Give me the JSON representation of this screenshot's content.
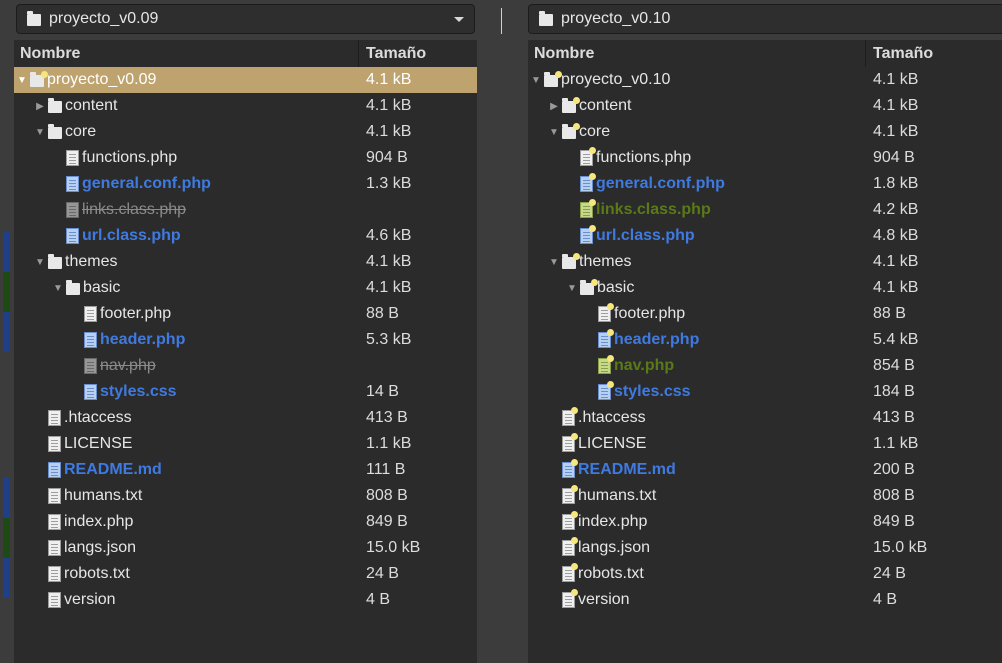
{
  "left": {
    "path": "proyecto_v0.09",
    "columns": {
      "name": "Nombre",
      "size": "Tamaño"
    },
    "rows": [
      {
        "name": "proyecto_v0.09",
        "size": "4.1 kB",
        "type": "folder",
        "state": "normal",
        "expander": "open",
        "depth": 0,
        "star": true,
        "selected": true
      },
      {
        "name": "content",
        "size": "4.1 kB",
        "type": "folder",
        "state": "normal",
        "expander": "closed",
        "depth": 1
      },
      {
        "name": "core",
        "size": "4.1 kB",
        "type": "folder",
        "state": "normal",
        "expander": "open",
        "depth": 1
      },
      {
        "name": "functions.php",
        "size": "904 B",
        "type": "file",
        "state": "normal",
        "depth": 2
      },
      {
        "name": "general.conf.php",
        "size": "1.3 kB",
        "type": "file",
        "state": "modified",
        "depth": 2
      },
      {
        "name": "links.class.php",
        "size": "",
        "type": "file",
        "state": "missing",
        "depth": 2
      },
      {
        "name": "url.class.php",
        "size": "4.6 kB",
        "type": "file",
        "state": "modified",
        "depth": 2
      },
      {
        "name": "themes",
        "size": "4.1 kB",
        "type": "folder",
        "state": "normal",
        "expander": "open",
        "depth": 1
      },
      {
        "name": "basic",
        "size": "4.1 kB",
        "type": "folder",
        "state": "normal",
        "expander": "open",
        "depth": 2
      },
      {
        "name": "footer.php",
        "size": "88 B",
        "type": "file",
        "state": "normal",
        "depth": 3
      },
      {
        "name": "header.php",
        "size": "5.3 kB",
        "type": "file",
        "state": "modified",
        "depth": 3
      },
      {
        "name": "nav.php",
        "size": "",
        "type": "file",
        "state": "missing",
        "depth": 3
      },
      {
        "name": "styles.css",
        "size": "14 B",
        "type": "file",
        "state": "modified",
        "depth": 3
      },
      {
        "name": ".htaccess",
        "size": "413 B",
        "type": "file",
        "state": "normal",
        "depth": 1
      },
      {
        "name": "LICENSE",
        "size": "1.1 kB",
        "type": "file",
        "state": "normal",
        "depth": 1
      },
      {
        "name": "README.md",
        "size": "111 B",
        "type": "file",
        "state": "modified",
        "depth": 1
      },
      {
        "name": "humans.txt",
        "size": "808 B",
        "type": "file",
        "state": "normal",
        "depth": 1
      },
      {
        "name": "index.php",
        "size": "849 B",
        "type": "file",
        "state": "normal",
        "depth": 1
      },
      {
        "name": "langs.json",
        "size": "15.0 kB",
        "type": "file",
        "state": "normal",
        "depth": 1
      },
      {
        "name": "robots.txt",
        "size": "24 B",
        "type": "file",
        "state": "normal",
        "depth": 1
      },
      {
        "name": "version",
        "size": "4 B",
        "type": "file",
        "state": "normal",
        "depth": 1
      }
    ]
  },
  "right": {
    "path": "proyecto_v0.10",
    "columns": {
      "name": "Nombre",
      "size": "Tamaño"
    },
    "rows": [
      {
        "name": "proyecto_v0.10",
        "size": "4.1 kB",
        "type": "folder",
        "state": "normal",
        "expander": "open",
        "depth": 0,
        "star": true
      },
      {
        "name": "content",
        "size": "4.1 kB",
        "type": "folder",
        "state": "normal",
        "expander": "closed",
        "depth": 1,
        "star": true
      },
      {
        "name": "core",
        "size": "4.1 kB",
        "type": "folder",
        "state": "normal",
        "expander": "open",
        "depth": 1,
        "star": true
      },
      {
        "name": "functions.php",
        "size": "904 B",
        "type": "file",
        "state": "normal",
        "depth": 2,
        "star": true
      },
      {
        "name": "general.conf.php",
        "size": "1.8 kB",
        "type": "file",
        "state": "modified",
        "depth": 2,
        "star": true
      },
      {
        "name": "links.class.php",
        "size": "4.2 kB",
        "type": "file",
        "state": "added",
        "depth": 2,
        "star": true
      },
      {
        "name": "url.class.php",
        "size": "4.8 kB",
        "type": "file",
        "state": "modified",
        "depth": 2,
        "star": true
      },
      {
        "name": "themes",
        "size": "4.1 kB",
        "type": "folder",
        "state": "normal",
        "expander": "open",
        "depth": 1,
        "star": true
      },
      {
        "name": "basic",
        "size": "4.1 kB",
        "type": "folder",
        "state": "normal",
        "expander": "open",
        "depth": 2,
        "star": true
      },
      {
        "name": "footer.php",
        "size": "88 B",
        "type": "file",
        "state": "normal",
        "depth": 3,
        "star": true
      },
      {
        "name": "header.php",
        "size": "5.4 kB",
        "type": "file",
        "state": "modified",
        "depth": 3,
        "star": true
      },
      {
        "name": "nav.php",
        "size": "854 B",
        "type": "file",
        "state": "added",
        "depth": 3,
        "star": true
      },
      {
        "name": "styles.css",
        "size": "184 B",
        "type": "file",
        "state": "modified",
        "depth": 3,
        "star": true
      },
      {
        "name": ".htaccess",
        "size": "413 B",
        "type": "file",
        "state": "normal",
        "depth": 1,
        "star": true
      },
      {
        "name": "LICENSE",
        "size": "1.1 kB",
        "type": "file",
        "state": "normal",
        "depth": 1,
        "star": true
      },
      {
        "name": "README.md",
        "size": "200 B",
        "type": "file",
        "state": "modified",
        "depth": 1,
        "star": true
      },
      {
        "name": "humans.txt",
        "size": "808 B",
        "type": "file",
        "state": "normal",
        "depth": 1,
        "star": true
      },
      {
        "name": "index.php",
        "size": "849 B",
        "type": "file",
        "state": "normal",
        "depth": 1,
        "star": true
      },
      {
        "name": "langs.json",
        "size": "15.0 kB",
        "type": "file",
        "state": "normal",
        "depth": 1,
        "star": true
      },
      {
        "name": "robots.txt",
        "size": "24 B",
        "type": "file",
        "state": "normal",
        "depth": 1,
        "star": true
      },
      {
        "name": "version",
        "size": "4 B",
        "type": "file",
        "state": "normal",
        "depth": 1,
        "star": true
      }
    ]
  },
  "colors": {
    "background": "#3c3c3c",
    "tree_background": "#2b2b2b",
    "selected_row": "#bfa36e",
    "modified_text": "#3f7ae0",
    "added_text": "#5a7a18",
    "missing_text": "#8a8a8a",
    "diff_mark_modified": "#1f3f8a",
    "diff_mark_added": "#1f4a14"
  },
  "gutter": [
    {
      "state": "modified"
    },
    {
      "state": "added"
    },
    {
      "state": "modified"
    },
    {
      "state": "modified"
    },
    {
      "state": "added"
    },
    {
      "state": "modified"
    }
  ]
}
